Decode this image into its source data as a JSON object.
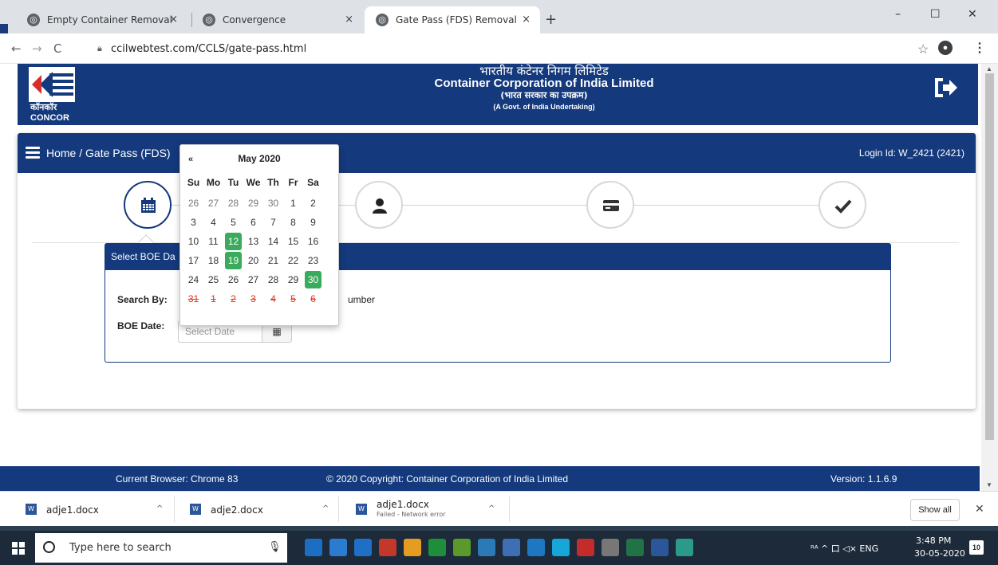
{
  "browser": {
    "tabs": [
      {
        "label": "Empty Container Removal Permi"
      },
      {
        "label": "Convergence"
      },
      {
        "label": "Gate Pass (FDS) Removal"
      }
    ],
    "tab_close": "×",
    "new_tab": "+",
    "window_controls": [
      "–",
      "☐",
      "✕"
    ],
    "nav": {
      "back": "←",
      "forward": "→",
      "reload": "C"
    },
    "url": "ccilwebtest.com/CCLS/gate-pass.html"
  },
  "header": {
    "logo_hindi": "कॉनकॉर",
    "logo_english": "CONCOR",
    "hindi_title": "भारतीय कंटेनर निगम लिमिटेड",
    "english_title": "Container Corporation of India Limited",
    "hindi_subtitle": "(भारत सरकार का उपक्रम)",
    "english_subtitle": "(A Govt. of India Undertaking)"
  },
  "app_bar": {
    "breadcrumb": "Home / Gate Pass (FDS)",
    "login_id": "Login Id: W_2421 (2421)"
  },
  "steps": [
    {
      "icon": "calendar-icon",
      "active": true
    },
    {
      "icon": "user-icon",
      "active": false
    },
    {
      "icon": "card-icon",
      "active": false
    },
    {
      "icon": "check-icon",
      "active": false
    }
  ],
  "panel": {
    "title": "Select BOE Da",
    "search_by_label": "Search By:",
    "search_by_rest": "umber",
    "boe_date_label": "BOE Date:",
    "date_placeholder": "Select Date",
    "date_button_icon": "▦"
  },
  "calendar": {
    "prev": "«",
    "month_year": "May 2020",
    "weekdays": [
      "Su",
      "Mo",
      "Tu",
      "We",
      "Th",
      "Fr",
      "Sa"
    ],
    "weeks": [
      [
        {
          "d": "26",
          "s": "muted"
        },
        {
          "d": "27",
          "s": "muted"
        },
        {
          "d": "28",
          "s": "muted"
        },
        {
          "d": "29",
          "s": "muted"
        },
        {
          "d": "30",
          "s": "muted"
        },
        {
          "d": "1",
          "s": ""
        },
        {
          "d": "2",
          "s": ""
        }
      ],
      [
        {
          "d": "3",
          "s": ""
        },
        {
          "d": "4",
          "s": ""
        },
        {
          "d": "5",
          "s": ""
        },
        {
          "d": "6",
          "s": ""
        },
        {
          "d": "7",
          "s": ""
        },
        {
          "d": "8",
          "s": ""
        },
        {
          "d": "9",
          "s": ""
        }
      ],
      [
        {
          "d": "10",
          "s": ""
        },
        {
          "d": "11",
          "s": ""
        },
        {
          "d": "12",
          "s": "hl"
        },
        {
          "d": "13",
          "s": ""
        },
        {
          "d": "14",
          "s": ""
        },
        {
          "d": "15",
          "s": ""
        },
        {
          "d": "16",
          "s": ""
        }
      ],
      [
        {
          "d": "17",
          "s": ""
        },
        {
          "d": "18",
          "s": ""
        },
        {
          "d": "19",
          "s": "hl"
        },
        {
          "d": "20",
          "s": ""
        },
        {
          "d": "21",
          "s": ""
        },
        {
          "d": "22",
          "s": ""
        },
        {
          "d": "23",
          "s": ""
        }
      ],
      [
        {
          "d": "24",
          "s": ""
        },
        {
          "d": "25",
          "s": ""
        },
        {
          "d": "26",
          "s": ""
        },
        {
          "d": "27",
          "s": ""
        },
        {
          "d": "28",
          "s": ""
        },
        {
          "d": "29",
          "s": ""
        },
        {
          "d": "30",
          "s": "hl"
        }
      ],
      [
        {
          "d": "31",
          "s": "disabled"
        },
        {
          "d": "1",
          "s": "disabled"
        },
        {
          "d": "2",
          "s": "disabled"
        },
        {
          "d": "3",
          "s": "disabled"
        },
        {
          "d": "4",
          "s": "disabled"
        },
        {
          "d": "5",
          "s": "disabled"
        },
        {
          "d": "6",
          "s": "disabled"
        }
      ]
    ]
  },
  "footer": {
    "browser": "Current Browser: Chrome 83",
    "copyright": "© 2020 Copyright: Container Corporation of India Limited",
    "version": "Version: 1.1.6.9"
  },
  "downloads": [
    {
      "name": "adje1.docx",
      "status": ""
    },
    {
      "name": "adje2.docx",
      "status": ""
    },
    {
      "name": "adje1.docx",
      "status": "Failed - Network error"
    }
  ],
  "download_chevron": "^",
  "show_all": "Show all",
  "download_close": "✕",
  "taskbar": {
    "search_placeholder": "Type here to search",
    "tray_text": "ᴿᴬ ^ 口 ◁× ENG",
    "time": "3:48 PM",
    "date": "30-05-2020",
    "notification_count": "10",
    "app_colors": [
      "#1b6ec2",
      "#2b7bd1",
      "#1f6fc6",
      "#c4372b",
      "#e49d20",
      "#1f8e3a",
      "#5a9a2a",
      "#2a7ab8",
      "#3e6fb5",
      "#1d77c2",
      "#16a7d8",
      "#c42b2b",
      "#777777",
      "#217346",
      "#2b579a",
      "#2a9a8a"
    ]
  },
  "colors": {
    "brand_navy": "#14397c",
    "calendar_highlight": "#3aaa5c",
    "disabled_date": "#e8341c"
  }
}
